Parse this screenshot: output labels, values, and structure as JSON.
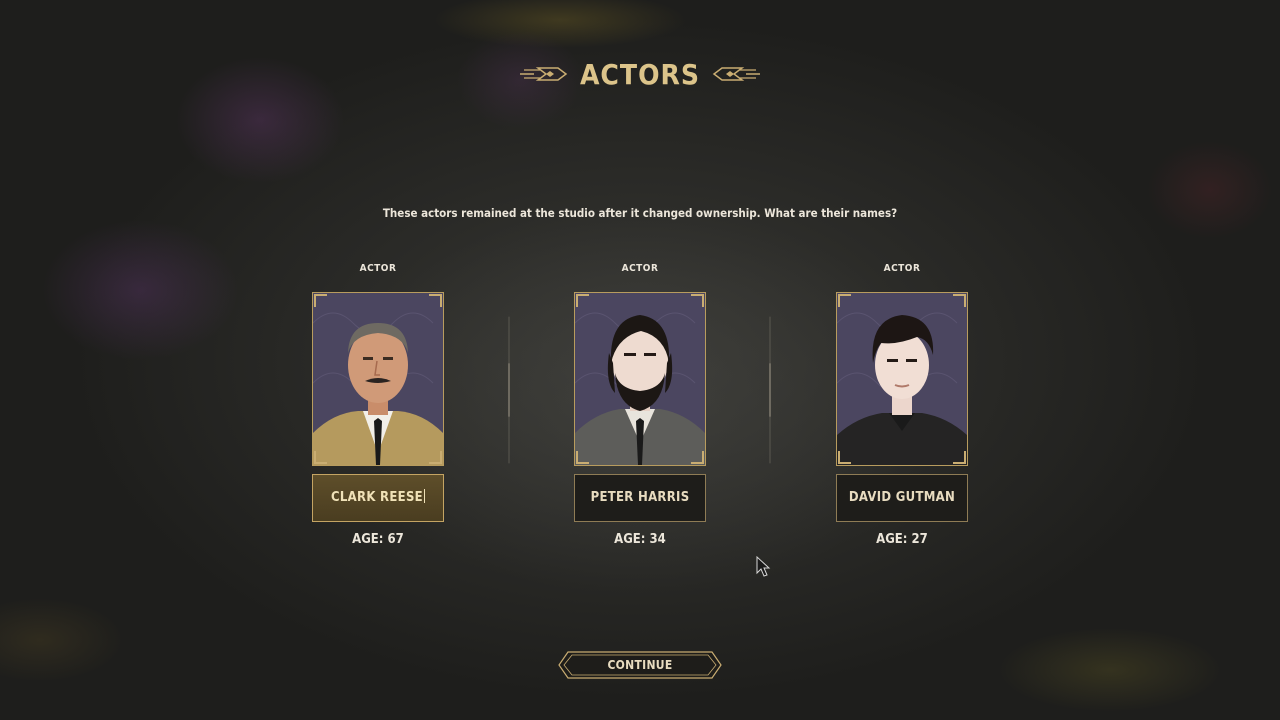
{
  "header": {
    "title": "ACTORS"
  },
  "prompt": "These actors remained at the studio after it changed ownership. What are their names?",
  "actors": [
    {
      "label": "ACTOR",
      "name": "CLARK REESE",
      "age": "AGE: 67",
      "portrait": "older-man-mustache-beige-suit",
      "editing": true
    },
    {
      "label": "ACTOR",
      "name": "PETER HARRIS",
      "age": "AGE: 34",
      "portrait": "bearded-man-gray-suit",
      "editing": false
    },
    {
      "label": "ACTOR",
      "name": "DAVID GUTMAN",
      "age": "AGE: 27",
      "portrait": "young-man-black-shirt",
      "editing": false
    }
  ],
  "buttons": {
    "continue": "CONTINUE"
  },
  "colors": {
    "accent_gold": "#dcc48a",
    "portrait_bg": "#4a4558",
    "active_field": "#5e4e2a"
  }
}
